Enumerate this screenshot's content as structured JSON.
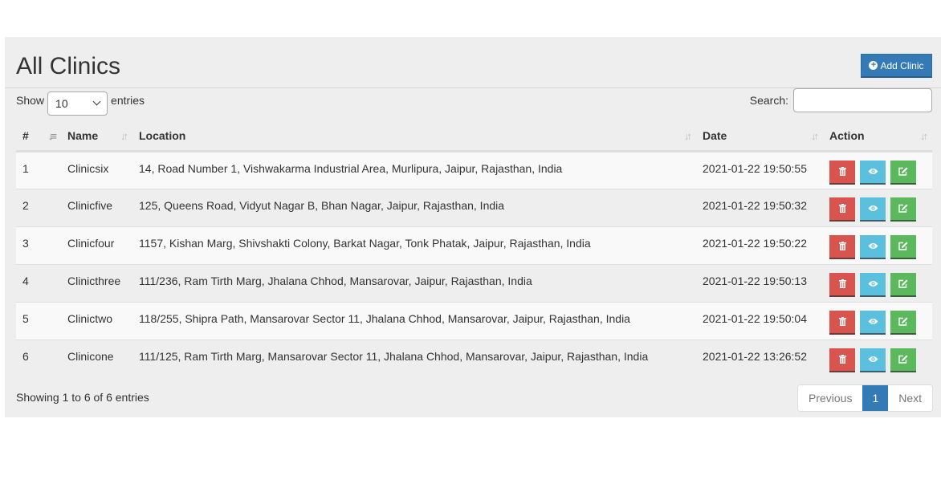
{
  "page": {
    "title": "All Clinics",
    "add_button_label": "Add Clinic",
    "add_button_icon": "plus-circle-icon"
  },
  "length_control": {
    "prefix": "Show",
    "selected": "10",
    "suffix": "entries"
  },
  "search": {
    "label": "Search:",
    "value": "",
    "placeholder": ""
  },
  "table": {
    "columns": [
      {
        "label": "#",
        "sort": "ascending"
      },
      {
        "label": "Name",
        "sort": "none"
      },
      {
        "label": "Location",
        "sort": "none"
      },
      {
        "label": "Date",
        "sort": "none"
      },
      {
        "label": "Action",
        "sort": "none"
      }
    ],
    "rows": [
      {
        "id": "1",
        "name": "Clinicsix",
        "location": "14, Road Number 1, Vishwakarma Industrial Area, Murlipura, Jaipur, Rajasthan, India",
        "date": "2021-01-22 19:50:55"
      },
      {
        "id": "2",
        "name": "Clinicfive",
        "location": "125, Queens Road, Vidyut Nagar B, Bhan Nagar, Jaipur, Rajasthan, India",
        "date": "2021-01-22 19:50:32"
      },
      {
        "id": "3",
        "name": "Clinicfour",
        "location": "1157, Kishan Marg, Shivshakti Colony, Barkat Nagar, Tonk Phatak, Jaipur, Rajasthan, India",
        "date": "2021-01-22 19:50:22"
      },
      {
        "id": "4",
        "name": "Clinicthree",
        "location": "111/236, Ram Tirth Marg, Jhalana Chhod, Mansarovar, Jaipur, Rajasthan, India",
        "date": "2021-01-22 19:50:13"
      },
      {
        "id": "5",
        "name": "Clinictwo",
        "location": "118/255, Shipra Path, Mansarovar Sector 11, Jhalana Chhod, Mansarovar, Jaipur, Rajasthan, India",
        "date": "2021-01-22 19:50:04"
      },
      {
        "id": "6",
        "name": "Clinicone",
        "location": "111/125, Ram Tirth Marg, Mansarovar Sector 11, Jhalana Chhod, Mansarovar, Jaipur, Rajasthan, India",
        "date": "2021-01-22 13:26:52"
      }
    ],
    "row_actions": [
      "delete",
      "view",
      "edit"
    ]
  },
  "footer": {
    "info": "Showing 1 to 6 of 6 entries",
    "pagination": {
      "previous": "Previous",
      "current": "1",
      "next": "Next"
    }
  },
  "colors": {
    "primary": "#337ab7",
    "danger": "#d9534f",
    "info": "#5bc0de",
    "success": "#5cb85c",
    "panel_bg": "#eeeeee"
  }
}
